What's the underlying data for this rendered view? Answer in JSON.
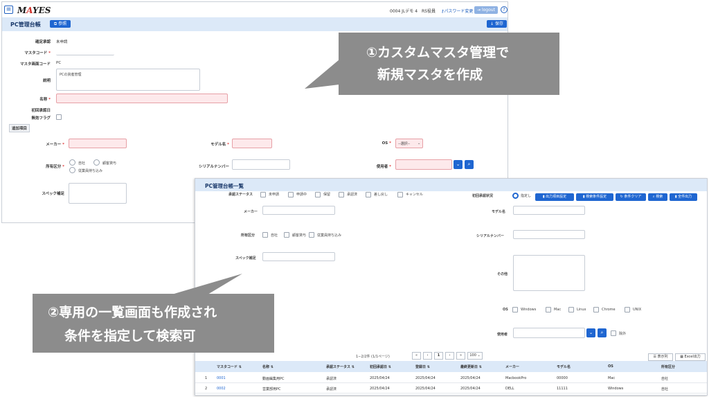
{
  "back": {
    "menu_icon": "≡",
    "logo_pre": "M",
    "logo_mid": "A",
    "logo_post": "YES",
    "user": "0004 JLデモ 4　RS役員",
    "password_change": "パスワード変更",
    "logout": "logout",
    "help_icon": "?",
    "title": "PC管理台帳",
    "ref_btn": "参照",
    "save_btn": "保存",
    "fields": {
      "status_label": "確定承認",
      "status_value": "未申請",
      "code_label": "マスタコード",
      "screen_code_label": "マスタ画面コード",
      "screen_code_value": "PC",
      "desc_label": "説明",
      "desc_value": "PCの資産管理",
      "name_label": "名称",
      "first_date_label": "初回承認日",
      "invalid_label": "無効フラグ",
      "extra_section": "追加項目",
      "maker_label": "メーカー",
      "model_label": "モデル名",
      "os_label": "OS",
      "os_select": "--選択--",
      "owner_label": "所有区分",
      "owner_opt1": "自社",
      "owner_opt2": "顧客貸与",
      "owner_opt3": "従業員持ち込み",
      "serial_label": "シリアルナンバー",
      "user_label": "使用者",
      "spec_label": "スペック補足"
    }
  },
  "front": {
    "title": "PC管理台帳一覧",
    "status_label": "承認ステータス",
    "status_opts": [
      "未申請",
      "申請中",
      "保留",
      "承認済",
      "差し戻し",
      "キャンセル"
    ],
    "first_status_label": "初回承認状況",
    "first_status_opt": "指定し",
    "buttons": [
      "出力項目設定",
      "検索条件設定",
      "条件クリア",
      "検索",
      "全件出力"
    ],
    "maker_label": "メーカー",
    "model_label": "モデル名",
    "owner_label": "所有区分",
    "owner_opts": [
      "自社",
      "顧客貸与",
      "従業員持ち込み"
    ],
    "serial_label": "シリアルナンバー",
    "spec_label": "スペック補足",
    "other_label": "その他",
    "os_label": "OS",
    "os_opts": [
      "Windows",
      "Mac",
      "Linux",
      "Chrome",
      "UNIX"
    ],
    "user_label": "使用者",
    "exclude_label": "除外",
    "pager": {
      "summary": "1−2/2件 (1/1ページ)",
      "first": "«",
      "prev": "‹",
      "current": "1",
      "next": "›",
      "last": "»",
      "per_page": "100"
    },
    "view_btn": "表示列",
    "excel_btn": "Excel出力",
    "columns": [
      "マスタコード ⇅",
      "名称 ⇅",
      "承認ステータス ⇅",
      "初回承認日 ⇅",
      "登録日 ⇅",
      "最終更新日 ⇅",
      "メーカー",
      "モデル名",
      "OS",
      "所有区分"
    ],
    "rows": [
      [
        "1",
        "0001",
        "動画編集用PC",
        "承認済",
        "2025/04/24",
        "2025/04/24",
        "2025/04/24",
        "MacbookPro",
        "00000",
        "Mac",
        "自社"
      ],
      [
        "2",
        "0002",
        "営業部用PC",
        "承認済",
        "2025/04/24",
        "2025/04/24",
        "2025/04/24",
        "DELL",
        "11111",
        "Windows",
        "自社"
      ]
    ]
  },
  "callout1": {
    "line1": "①カスタムマスタ管理で",
    "line2": "新規マスタを作成"
  },
  "callout2": {
    "line1": "②専用の一覧画面も作成され",
    "line2": "条件を指定して検索可"
  }
}
